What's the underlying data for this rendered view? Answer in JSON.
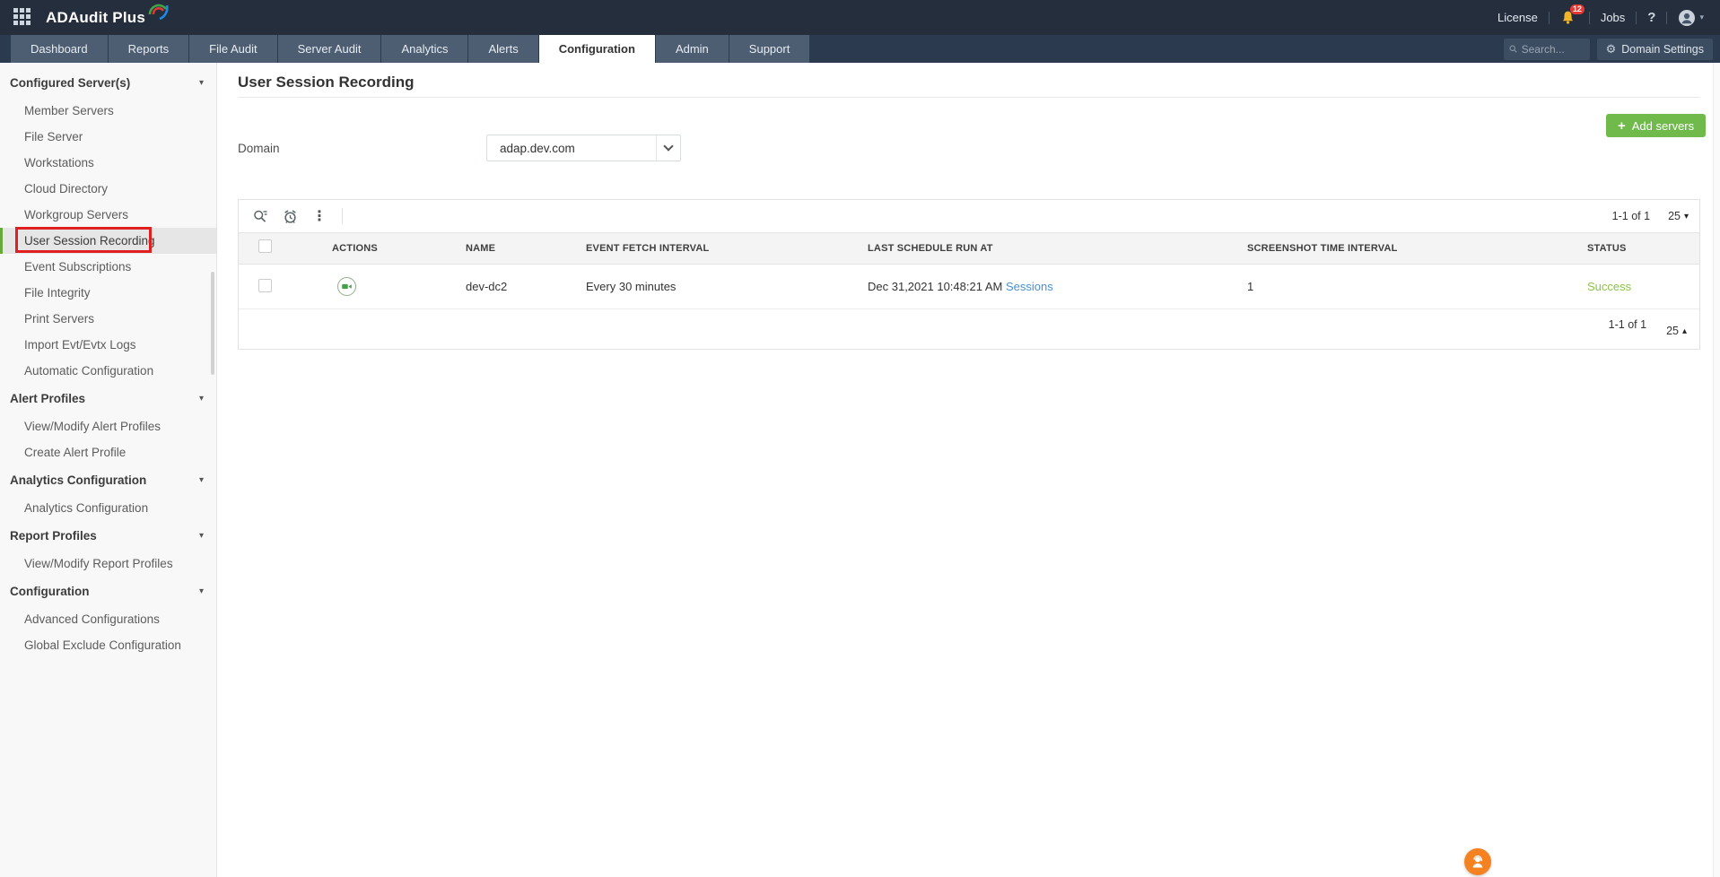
{
  "topbar": {
    "brand": "ADAudit Plus",
    "license": "License",
    "jobs": "Jobs",
    "notification_count": "12",
    "help": "?"
  },
  "nav": {
    "tabs": [
      "Dashboard",
      "Reports",
      "File Audit",
      "Server Audit",
      "Analytics",
      "Alerts",
      "Configuration",
      "Admin",
      "Support"
    ],
    "active_tab": "Configuration",
    "search_placeholder": "Search...",
    "domain_settings": "Domain Settings"
  },
  "sidebar": {
    "sections": [
      {
        "label": "Configured Server(s)",
        "items": [
          "Member Servers",
          "File Server",
          "Workstations",
          "Cloud Directory",
          "Workgroup Servers",
          "User Session Recording",
          "Event Subscriptions",
          "File Integrity",
          "Print Servers",
          "Import Evt/Evtx Logs",
          "Automatic Configuration"
        ]
      },
      {
        "label": "Alert Profiles",
        "items": [
          "View/Modify Alert Profiles",
          "Create Alert Profile"
        ]
      },
      {
        "label": "Analytics Configuration",
        "items": [
          "Analytics Configuration"
        ]
      },
      {
        "label": "Report Profiles",
        "items": [
          "View/Modify Report Profiles"
        ]
      },
      {
        "label": "Configuration",
        "items": [
          "Advanced Configurations",
          "Global Exclude Configuration"
        ]
      }
    ],
    "selected_item": "User Session Recording"
  },
  "main": {
    "title": "User Session Recording",
    "domain_label": "Domain",
    "domain_value": "adap.dev.com",
    "add_servers": "Add servers",
    "table": {
      "columns": [
        "ACTIONS",
        "NAME",
        "EVENT FETCH INTERVAL",
        "LAST SCHEDULE RUN AT",
        "SCREENSHOT TIME INTERVAL",
        "STATUS"
      ],
      "rows": [
        {
          "name": "dev-dc2",
          "event_fetch_interval": "Every 30 minutes",
          "last_schedule_run_at": "Dec 31,2021 10:48:21 AM",
          "sessions_link": "Sessions",
          "screenshot_time_interval": "1",
          "status": "Success"
        }
      ],
      "pagination_top": {
        "range": "1-1 of 1",
        "page_size": "25"
      },
      "pagination_bottom": {
        "range": "1-1 of 1",
        "page_size": "25"
      }
    }
  },
  "icons": {
    "caret_down": "▾",
    "caret_up": "▴",
    "plus": "+",
    "kebab": "⋮",
    "gear": "⚙"
  },
  "colors": {
    "accent_green": "#6fba4a",
    "status_success": "#8bc34a",
    "link_blue": "#4a90d2",
    "badge_red": "#e53935",
    "bell_yellow": "#f0b429",
    "annotation_red": "#e02020",
    "topbar_navy": "#242e3d"
  }
}
